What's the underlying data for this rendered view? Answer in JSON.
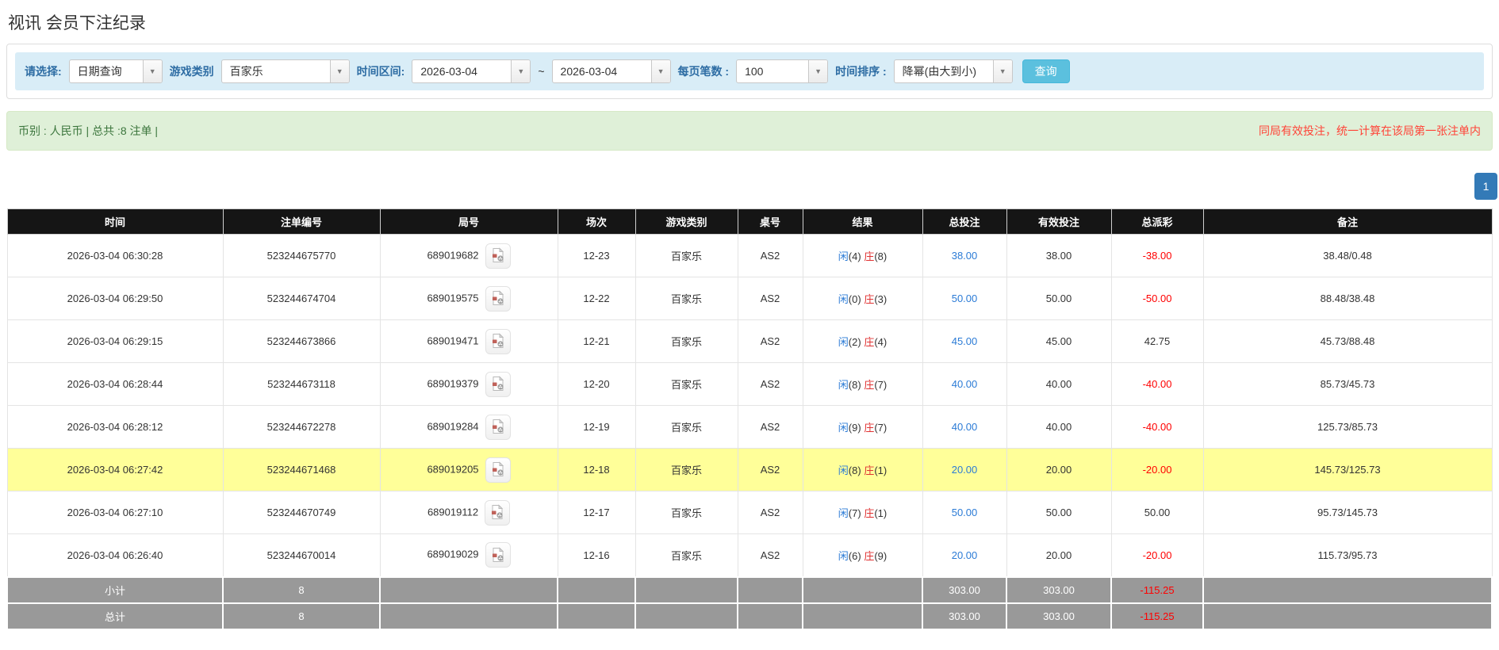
{
  "page_title": "视讯 会员下注纪录",
  "filters": {
    "select_label": "请选择:",
    "select_value": "日期查询",
    "game_label": "游戏类别",
    "game_value": "百家乐",
    "range_label": "时间区间:",
    "date_from": "2026-03-04",
    "range_separator": "~",
    "date_to": "2026-03-04",
    "per_page_label": "每页笔数 :",
    "per_page_value": "100",
    "sort_label": "时间排序 :",
    "sort_value": "降幂(由大到小)",
    "search_label": "查询"
  },
  "summary_bar": {
    "left_text": "币别 : 人民币 | 总共 :8 注单 |",
    "right_note": "同局有效投注，统一计算在该局第一张注单内"
  },
  "pagination": {
    "pages": [
      "1"
    ]
  },
  "icons": {
    "dropdown_arrow_glyph": "▼",
    "video_replay": "video-replay-icon"
  },
  "colors": {
    "filter_bar_bg": "#d9edf7",
    "label_blue": "#2e6da4",
    "search_button_bg": "#5bc0de",
    "alert_bg": "#dff0d8",
    "alert_green_text": "#3c763d",
    "alert_red_text": "#ff4438",
    "pagination_bg": "#337ab7",
    "table_header_bg": "#151515",
    "highlight_row_bg": "#ffff99",
    "footer_row_bg": "#999999",
    "link_blue": "#2b7bd6",
    "banker_red": "#e03131",
    "negative_red": "#ff0000"
  },
  "table": {
    "headers": [
      "时间",
      "注单编号",
      "局号",
      "场次",
      "游戏类别",
      "桌号",
      "结果",
      "总投注",
      "有效投注",
      "总派彩",
      "备注"
    ],
    "rows": [
      {
        "time": "2026-03-04 06:30:28",
        "bet_id": "523244675770",
        "round_id": "689019682",
        "session": "12-23",
        "game": "百家乐",
        "table_no": "AS2",
        "result_player": "闲",
        "result_player_n": "(4)",
        "result_banker": "庄",
        "result_banker_n": "(8)",
        "total_bet": "38.00",
        "valid_bet": "38.00",
        "payout": "-38.00",
        "remark": "38.48/0.48",
        "highlight": false
      },
      {
        "time": "2026-03-04 06:29:50",
        "bet_id": "523244674704",
        "round_id": "689019575",
        "session": "12-22",
        "game": "百家乐",
        "table_no": "AS2",
        "result_player": "闲",
        "result_player_n": "(0)",
        "result_banker": "庄",
        "result_banker_n": "(3)",
        "total_bet": "50.00",
        "valid_bet": "50.00",
        "payout": "-50.00",
        "remark": "88.48/38.48",
        "highlight": false
      },
      {
        "time": "2026-03-04 06:29:15",
        "bet_id": "523244673866",
        "round_id": "689019471",
        "session": "12-21",
        "game": "百家乐",
        "table_no": "AS2",
        "result_player": "闲",
        "result_player_n": "(2)",
        "result_banker": "庄",
        "result_banker_n": "(4)",
        "total_bet": "45.00",
        "valid_bet": "45.00",
        "payout": "42.75",
        "remark": "45.73/88.48",
        "highlight": false
      },
      {
        "time": "2026-03-04 06:28:44",
        "bet_id": "523244673118",
        "round_id": "689019379",
        "session": "12-20",
        "game": "百家乐",
        "table_no": "AS2",
        "result_player": "闲",
        "result_player_n": "(8)",
        "result_banker": "庄",
        "result_banker_n": "(7)",
        "total_bet": "40.00",
        "valid_bet": "40.00",
        "payout": "-40.00",
        "remark": "85.73/45.73",
        "highlight": false
      },
      {
        "time": "2026-03-04 06:28:12",
        "bet_id": "523244672278",
        "round_id": "689019284",
        "session": "12-19",
        "game": "百家乐",
        "table_no": "AS2",
        "result_player": "闲",
        "result_player_n": "(9)",
        "result_banker": "庄",
        "result_banker_n": "(7)",
        "total_bet": "40.00",
        "valid_bet": "40.00",
        "payout": "-40.00",
        "remark": "125.73/85.73",
        "highlight": false
      },
      {
        "time": "2026-03-04 06:27:42",
        "bet_id": "523244671468",
        "round_id": "689019205",
        "session": "12-18",
        "game": "百家乐",
        "table_no": "AS2",
        "result_player": "闲",
        "result_player_n": "(8)",
        "result_banker": "庄",
        "result_banker_n": "(1)",
        "total_bet": "20.00",
        "valid_bet": "20.00",
        "payout": "-20.00",
        "remark": "145.73/125.73",
        "highlight": true
      },
      {
        "time": "2026-03-04 06:27:10",
        "bet_id": "523244670749",
        "round_id": "689019112",
        "session": "12-17",
        "game": "百家乐",
        "table_no": "AS2",
        "result_player": "闲",
        "result_player_n": "(7)",
        "result_banker": "庄",
        "result_banker_n": "(1)",
        "total_bet": "50.00",
        "valid_bet": "50.00",
        "payout": "50.00",
        "remark": "95.73/145.73",
        "highlight": false
      },
      {
        "time": "2026-03-04 06:26:40",
        "bet_id": "523244670014",
        "round_id": "689019029",
        "session": "12-16",
        "game": "百家乐",
        "table_no": "AS2",
        "result_player": "闲",
        "result_player_n": "(6)",
        "result_banker": "庄",
        "result_banker_n": "(9)",
        "total_bet": "20.00",
        "valid_bet": "20.00",
        "payout": "-20.00",
        "remark": "115.73/95.73",
        "highlight": false
      }
    ],
    "footer_rows": [
      {
        "label": "小计",
        "count": "8",
        "total_bet": "303.00",
        "valid_bet": "303.00",
        "payout": "-115.25"
      },
      {
        "label": "总计",
        "count": "8",
        "total_bet": "303.00",
        "valid_bet": "303.00",
        "payout": "-115.25"
      }
    ]
  }
}
